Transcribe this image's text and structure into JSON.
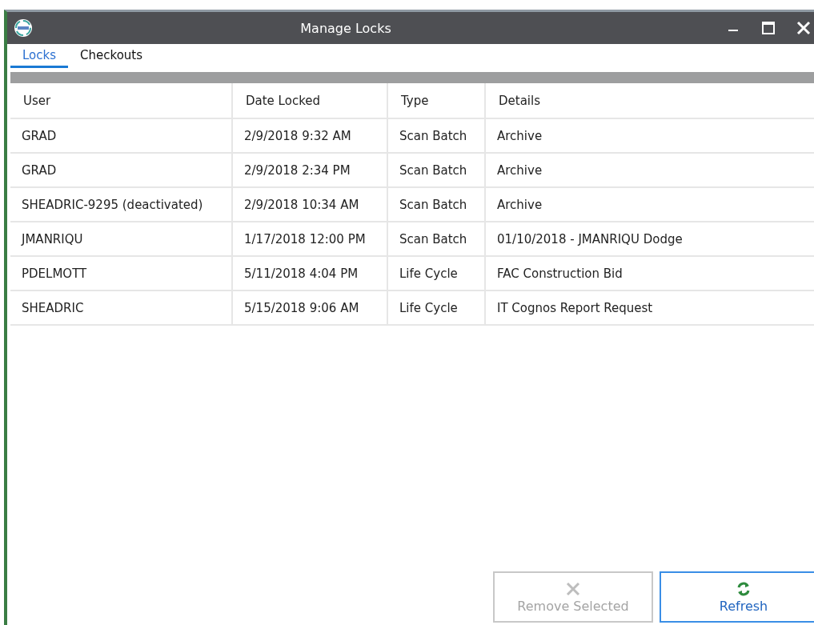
{
  "window": {
    "title": "Manage Locks"
  },
  "tabs": [
    {
      "label": "Locks",
      "selected": true
    },
    {
      "label": "Checkouts",
      "selected": false
    }
  ],
  "table": {
    "columns": [
      "User",
      "Date Locked",
      "Type",
      "Details"
    ],
    "rows": [
      [
        "GRAD",
        "2/9/2018 9:32 AM",
        "Scan Batch",
        "Archive"
      ],
      [
        "GRAD",
        "2/9/2018 2:34 PM",
        "Scan Batch",
        "Archive"
      ],
      [
        "SHEADRIC-9295 (deactivated)",
        "2/9/2018 10:34 AM",
        "Scan Batch",
        "Archive"
      ],
      [
        "JMANRIQU",
        "1/17/2018 12:00 PM",
        "Scan Batch",
        "01/10/2018 - JMANRIQU Dodge"
      ],
      [
        "PDELMOTT",
        "5/11/2018 4:04 PM",
        "Life Cycle",
        "FAC Construction Bid"
      ],
      [
        "SHEADRIC",
        "5/15/2018 9:06 AM",
        "Life Cycle",
        "IT Cognos Report Request"
      ]
    ]
  },
  "buttons": [
    {
      "label": "Remove Selected",
      "kind": "remove",
      "disabled": true
    },
    {
      "label": "Refresh",
      "kind": "refresh",
      "disabled": false
    }
  ]
}
